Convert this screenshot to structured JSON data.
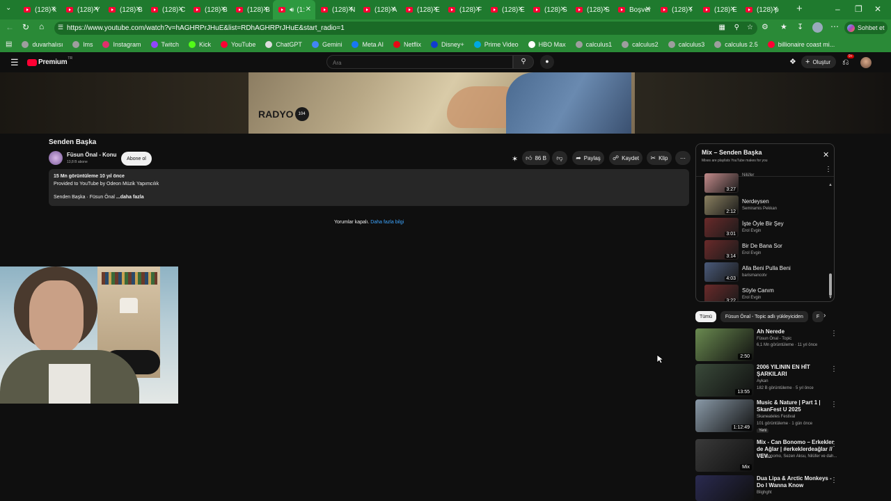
{
  "browser": {
    "tabs": [
      {
        "label": "(128) k"
      },
      {
        "label": "(128) Y"
      },
      {
        "label": "(128) B"
      },
      {
        "label": "(128) C"
      },
      {
        "label": "(128) B"
      },
      {
        "label": "(128) B"
      },
      {
        "label": "(1:"
      },
      {
        "label": "(128) N"
      },
      {
        "label": "(128) A"
      },
      {
        "label": "(128) E"
      },
      {
        "label": "(128) F"
      },
      {
        "label": "(128) E"
      },
      {
        "label": "(128) S"
      },
      {
        "label": "(128) S"
      },
      {
        "label": "Boşver"
      },
      {
        "label": "(128) I"
      },
      {
        "label": "(128) E"
      },
      {
        "label": "(128) p"
      }
    ],
    "url": "https://www.youtube.com/watch?v=hAGHRPrJHuE&list=RDhAGHRPrJHuE&start_radio=1",
    "copilot_label": "Sohbet et",
    "bookmarks": [
      {
        "label": "duvarhalısı",
        "color": "#9e9e9e"
      },
      {
        "label": "lms",
        "color": "#9e9e9e"
      },
      {
        "label": "Instagram",
        "color": "#e1306c"
      },
      {
        "label": "Twitch",
        "color": "#9146ff"
      },
      {
        "label": "Kick",
        "color": "#53fc18"
      },
      {
        "label": "YouTube",
        "color": "#ff0033"
      },
      {
        "label": "ChatGPT",
        "color": "#dddddd"
      },
      {
        "label": "Gemini",
        "color": "#4285f4"
      },
      {
        "label": "Meta AI",
        "color": "#1877f2"
      },
      {
        "label": "Netflix",
        "color": "#e50914"
      },
      {
        "label": "Disney+",
        "color": "#113ccf"
      },
      {
        "label": "Prime Video",
        "color": "#00a8e1"
      },
      {
        "label": "HBO Max",
        "color": "#ffffff"
      },
      {
        "label": "calculus1",
        "color": "#9e9e9e"
      },
      {
        "label": "calculus2",
        "color": "#9e9e9e"
      },
      {
        "label": "calculus3",
        "color": "#9e9e9e"
      },
      {
        "label": "calculus 2.5",
        "color": "#9e9e9e"
      },
      {
        "label": "billionaire coast mi...",
        "color": "#ff0033"
      }
    ]
  },
  "yt": {
    "logo": "Premium",
    "logo_sup": "TR",
    "search_placeholder": "Ara",
    "create_label": "Oluştur",
    "notif_count": "9+",
    "video_overlay_text": "RADYO",
    "video_overlay_badge": "104",
    "video_title": "Senden Başka",
    "channel_name": "Füsun Önal - Konu",
    "subscribers": "13,8 B abone",
    "subscribe_label": "Abone ol",
    "like_count": "86 B",
    "share_label": "Paylaş",
    "save_label": "Kaydet",
    "clip_label": "Klip",
    "desc_stats": "15 Mn görüntüleme  10 yıl önce",
    "desc_line2": "Provided to YouTube by Odeon Müzik Yapımcılık",
    "desc_line3": "Senden Başka · Füsun Önal",
    "desc_more": "...daha fazla",
    "comments_off": "Yorumlar kapalı.",
    "comments_more": "Daha fazla bilgi"
  },
  "mix": {
    "title": "Mix – Senden Başka",
    "subtitle": "Mixes are playlists YouTube makes for you",
    "items": [
      {
        "title": "",
        "channel": "Nilüfer",
        "duration": "3:27",
        "color": "#c28a8a"
      },
      {
        "title": "Nerdeysen",
        "channel": "Semiramis Pekkan",
        "duration": "2:12",
        "color": "#8a8060"
      },
      {
        "title": "İşte Öyle Bir Şey",
        "channel": "Erol Evgin",
        "duration": "3:01",
        "color": "#6a2a2a"
      },
      {
        "title": "Bir De Bana Sor",
        "channel": "Erol Evgin",
        "duration": "3:14",
        "color": "#6a2a2a"
      },
      {
        "title": "Alla Beni Pulla Beni",
        "channel": "barismancotv",
        "duration": "4:03",
        "color": "#4a5a7a"
      },
      {
        "title": "Söyle Canım",
        "channel": "Erol Evgin",
        "duration": "3:22",
        "color": "#6a2a2a"
      }
    ]
  },
  "chips": [
    {
      "label": "Tümü"
    },
    {
      "label": "Füsun Önal - Topic adlı yükleyiciden"
    },
    {
      "label": "F"
    }
  ],
  "recs": [
    {
      "title": "Ah Nerede",
      "channel": "Füsun Önal - Topic",
      "stats": "6,1 Mn görüntüleme · 11 yıl önce",
      "duration": "2:50",
      "badge": "",
      "color": "#6a8a50"
    },
    {
      "title": "2006 YILININ EN HİT ŞARKILARI",
      "channel": "Aykan",
      "stats": "182 B görüntüleme · 5 yıl önce",
      "duration": "13:55",
      "badge": "",
      "color": "#3a4a3a"
    },
    {
      "title": "Music & Nature | Part 1 | SkanFest U 2025",
      "channel": "Skaneateles Festival",
      "stats": "101 görüntüleme · 1 gün önce",
      "duration": "1:12:49",
      "badge": "Yeni",
      "color": "#8a9aa8"
    },
    {
      "title": "Mix - Can Bonomo – Erkekler de Ağlar | #erkeklerdeağlar // VEV...",
      "channel": "Can Bonomo, Sezen Aksu, Nilüfer ve dah...",
      "stats": "",
      "duration": "Mix",
      "badge": "",
      "color": "#3a3a3a"
    },
    {
      "title": "Dua Lipa & Arctic Monkeys - Do I Wanna Know",
      "channel": "Blighght",
      "stats": "",
      "duration": "",
      "badge": "",
      "color": "#2a2a50"
    }
  ]
}
